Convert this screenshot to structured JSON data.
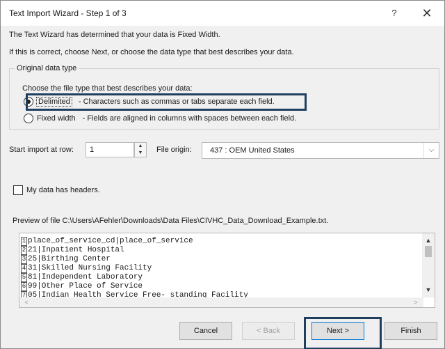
{
  "window": {
    "title": "Text Import Wizard - Step 1 of 3",
    "help_label": "?",
    "close_label": "✕"
  },
  "info": {
    "line1": "The Text Wizard has determined that your data is Fixed Width.",
    "line2": "If this is correct, choose Next, or choose the data type that best describes your data."
  },
  "original_data_type": {
    "legend": "Original data type",
    "prompt": "Choose the file type that best describes your data:",
    "options": [
      {
        "label": "Delimited",
        "description": "- Characters such as commas or tabs separate each field.",
        "selected": true
      },
      {
        "label": "Fixed width",
        "description": "- Fields are aligned in columns with spaces between each field.",
        "selected": false
      }
    ]
  },
  "import": {
    "start_label": "Start import at row:",
    "start_value": "1",
    "origin_label": "File origin:",
    "origin_value": "437 : OEM United States"
  },
  "headers_checkbox": {
    "label": "My data has headers.",
    "checked": false
  },
  "preview": {
    "label": "Preview of file C:\\Users\\AFehler\\Downloads\\Data Files\\CIVHC_Data_Download_Example.txt.",
    "lines": [
      {
        "num": "1",
        "text": "place_of_service_cd|place_of_service"
      },
      {
        "num": "2",
        "text": "21|Inpatient Hospital"
      },
      {
        "num": "3",
        "text": "25|Birthing Center"
      },
      {
        "num": "4",
        "text": "31|Skilled Nursing Facility"
      },
      {
        "num": "5",
        "text": "81|Independent Laboratory"
      },
      {
        "num": "6",
        "text": "99|Other Place of Service"
      },
      {
        "num": "7",
        "text": "05|Indian Health Service Free- standing Facility"
      }
    ]
  },
  "buttons": {
    "cancel": "Cancel",
    "back": "< Back",
    "next": "Next >",
    "finish": "Finish"
  },
  "colors": {
    "highlight": "#1f3f5f",
    "focus": "#0078d7"
  }
}
